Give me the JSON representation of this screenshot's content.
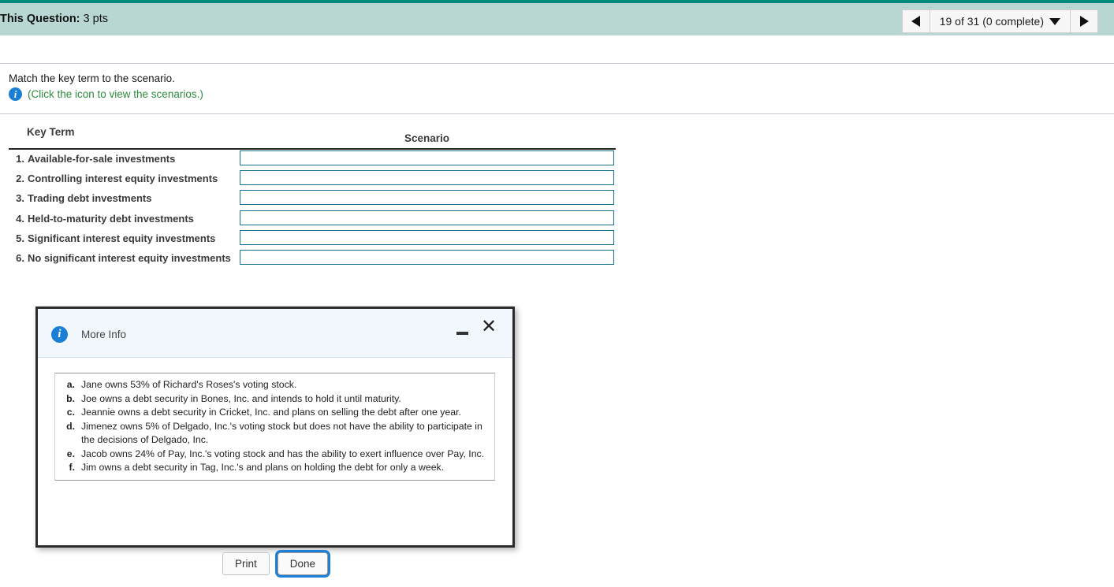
{
  "banner": {
    "label": "This Question:",
    "points": "3 pts",
    "accent_color": "#00897b",
    "background_color": "#b8d7d2"
  },
  "navigation": {
    "prev_icon": "triangle-left-icon",
    "next_icon": "triangle-right-icon",
    "counter": "19 of 31 (0 complete)",
    "dropdown_icon": "caret-down-icon"
  },
  "question": {
    "prompt": "Match the key term to the scenario.",
    "hint": "(Click the icon to view the scenarios.)",
    "hint_color": "#2e8b3d",
    "info_icon": "info-circle-icon"
  },
  "table": {
    "headers": {
      "key_term": "Key Term",
      "scenario": "Scenario"
    },
    "rows": [
      {
        "num": "1.",
        "term": "Available-for-sale investments",
        "value": "",
        "placeholder": ""
      },
      {
        "num": "2.",
        "term": "Controlling interest equity investments",
        "value": "",
        "placeholder": ""
      },
      {
        "num": "3.",
        "term": "Trading debt investments",
        "value": "",
        "placeholder": ""
      },
      {
        "num": "4.",
        "term": "Held-to-maturity debt investments",
        "value": "",
        "placeholder": ""
      },
      {
        "num": "5.",
        "term": "Significant interest equity investments",
        "value": "",
        "placeholder": ""
      },
      {
        "num": "6.",
        "term": "No significant interest equity investments",
        "value": "",
        "placeholder": ""
      }
    ]
  },
  "modal": {
    "title": "More Info",
    "info_icon": "info-circle-icon",
    "minimize_icon": "minimize-icon",
    "close_icon": "close-icon",
    "close_glyph": "✕",
    "scenarios": [
      {
        "letter": "a.",
        "text": "Jane owns 53% of Richard's Roses's voting stock."
      },
      {
        "letter": "b.",
        "text": "Joe owns a debt security in Bones, Inc. and intends to hold it until maturity."
      },
      {
        "letter": "c.",
        "text": "Jeannie owns a debt security in Cricket, Inc. and plans on selling the debt after one year."
      },
      {
        "letter": "d.",
        "text": "Jimenez owns 5% of Delgado, Inc.'s voting stock but does not have the ability to participate in the decisions of Delgado, Inc."
      },
      {
        "letter": "e.",
        "text": "Jacob owns 24% of Pay, Inc.'s voting stock and has the ability to exert influence over Pay, Inc."
      },
      {
        "letter": "f.",
        "text": "Jim owns a debt security in Tag, Inc.'s and plans on holding the debt for only a week."
      }
    ],
    "buttons": {
      "print": "Print",
      "done": "Done",
      "focus_color": "#1d7fd8"
    }
  }
}
